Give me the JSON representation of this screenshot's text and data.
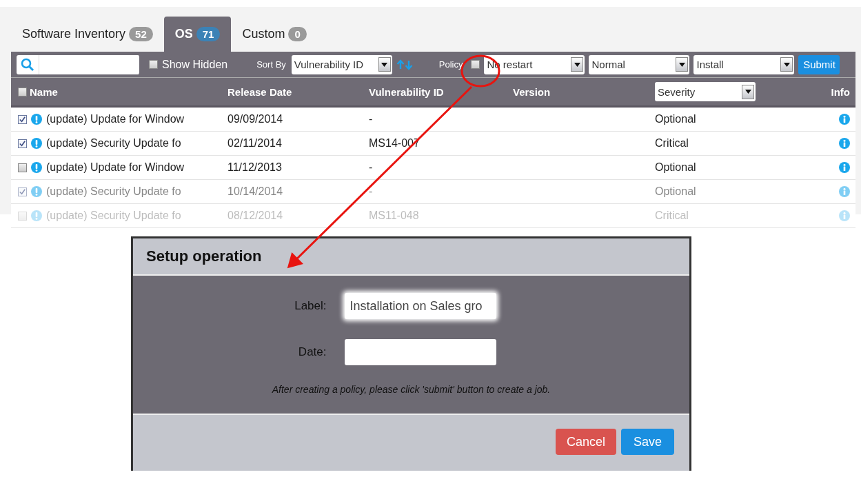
{
  "tabs": [
    {
      "label": "Software Inventory",
      "count": "52",
      "selected": false
    },
    {
      "label": "OS",
      "count": "71",
      "selected": true
    },
    {
      "label": "Custom",
      "count": "0",
      "selected": false
    }
  ],
  "toolbar": {
    "show_hidden": {
      "label": "Show Hidden",
      "checked": false
    },
    "sort_by": {
      "label": "Sort By",
      "value": "Vulnerability ID"
    },
    "policy": {
      "label": "Policy",
      "checked": false
    },
    "selects": [
      {
        "value": "No restart"
      },
      {
        "value": "Normal"
      },
      {
        "value": "Install"
      }
    ],
    "submit": "Submit"
  },
  "table": {
    "select_all": {
      "checked": false
    },
    "columns": [
      "Name",
      "Release Date",
      "Vulnerability ID",
      "Version",
      "Info"
    ],
    "severity_filter": "Severity",
    "rows": [
      {
        "checked": true,
        "kind": "normal",
        "name": "(update) Update for Window",
        "release_date": "09/09/2014",
        "vulnerability_id": "-",
        "severity": "Optional"
      },
      {
        "checked": true,
        "kind": "normal",
        "name": "(update) Security Update fo",
        "release_date": "02/11/2014",
        "vulnerability_id": "MS14-007",
        "severity": "Critical"
      },
      {
        "checked": false,
        "kind": "normal",
        "name": "(update) Update for Window",
        "release_date": "11/12/2013",
        "vulnerability_id": "-",
        "severity": "Optional"
      },
      {
        "checked": true,
        "kind": "faded",
        "name": "(update) Security Update fo",
        "release_date": "10/14/2014",
        "vulnerability_id": "-",
        "severity": "Optional"
      },
      {
        "checked": false,
        "kind": "faint",
        "name": "(update) Security Update fo",
        "release_date": "08/12/2014",
        "vulnerability_id": "MS11-048",
        "severity": "Critical"
      }
    ]
  },
  "dialog": {
    "title": "Setup operation",
    "fields": [
      {
        "label": "Label:",
        "value": "Installation on Sales gro",
        "focused": true
      },
      {
        "label": "Date:",
        "focused": false
      }
    ],
    "note": "After creating a policy, please click 'submit' button to create a job.",
    "buttons": [
      {
        "kind": "cancel",
        "label": "Cancel"
      },
      {
        "kind": "primary",
        "label": "Save"
      }
    ]
  }
}
